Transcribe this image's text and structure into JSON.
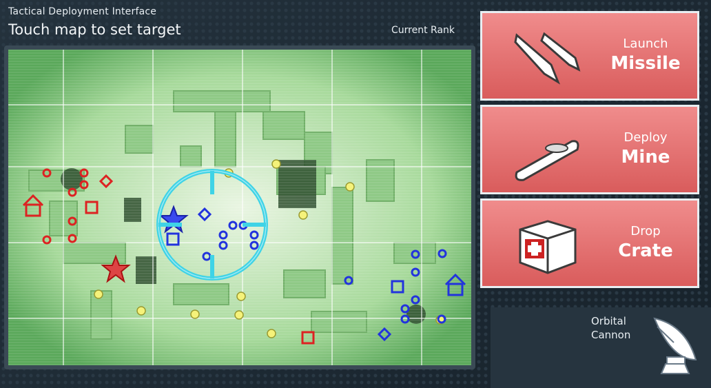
{
  "header": {
    "subtitle": "Tactical Deployment Interface",
    "title": "Touch map to set target"
  },
  "rank": {
    "label": "Current Rank"
  },
  "buttons": [
    {
      "sub": "Launch",
      "main": "Missile",
      "icon": "missile-icon"
    },
    {
      "sub": "Deploy",
      "main": "Mine",
      "icon": "mine-icon"
    },
    {
      "sub": "Drop",
      "main": "Crate",
      "icon": "medkit-crate-icon"
    }
  ],
  "orbital": {
    "line1": "Orbital",
    "line2": "Cannon",
    "icon": "satellite-dish-icon"
  },
  "colors": {
    "red_team": "#dd2222",
    "blue_team": "#2233dd",
    "neutral": "#f5f27a",
    "crosshair": "#3fd3e6",
    "button": "#e27373"
  }
}
